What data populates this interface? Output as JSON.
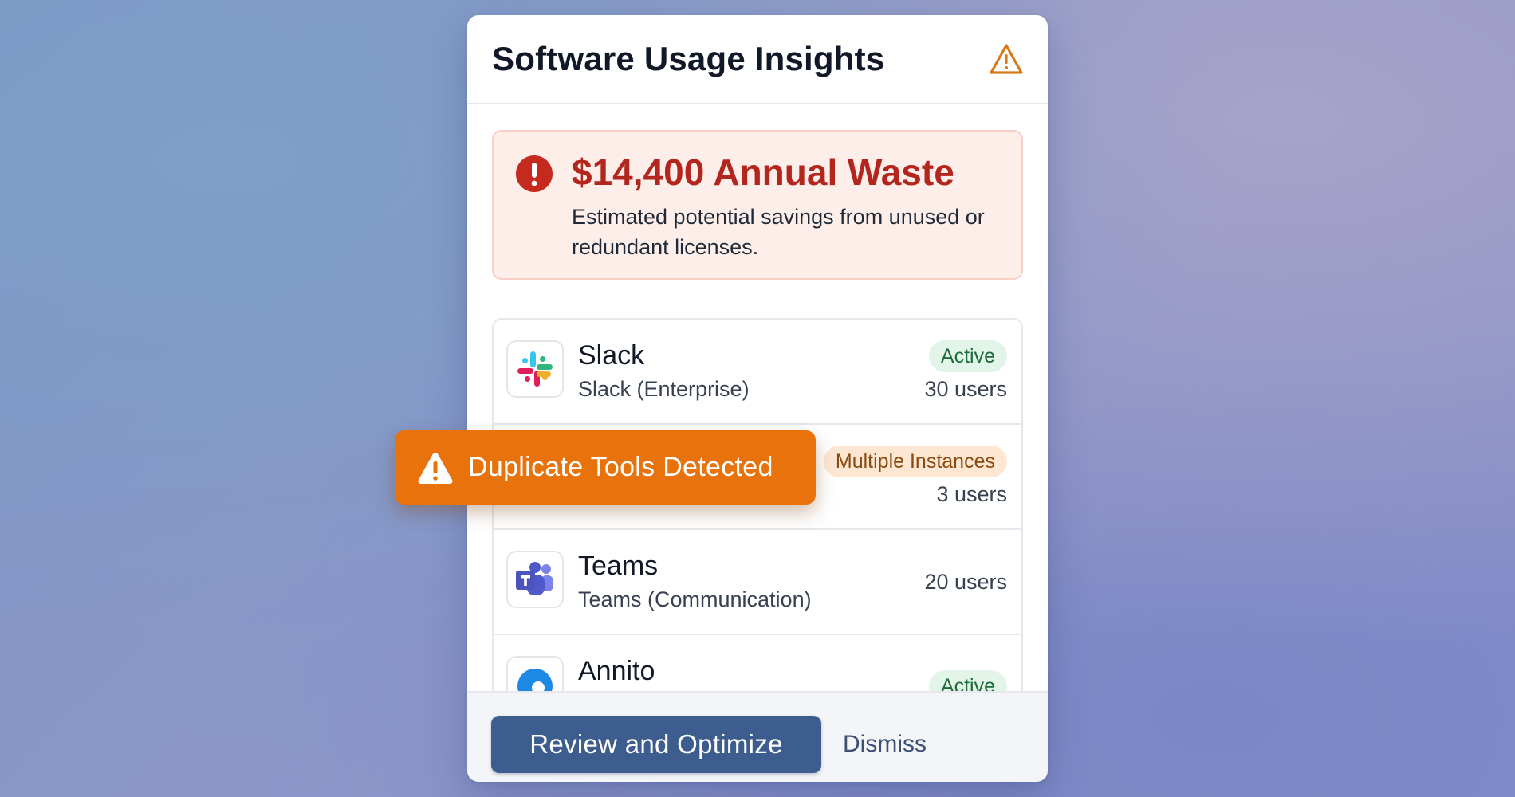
{
  "card": {
    "title": "Software Usage Insights",
    "header_icon": "warning-triangle-icon"
  },
  "waste": {
    "icon": "error-circle-icon",
    "amount": "$14,400 Annual Waste",
    "description": "Estimated potential savings from unused or redundant licenses."
  },
  "apps": [
    {
      "name": "Slack",
      "subtitle": "Slack (Enterprise)",
      "badge": "Active",
      "users": "30 users",
      "logo": "slack-logo-icon"
    },
    {
      "name": "",
      "subtitle": "",
      "badge": "Multiple Instances",
      "users": "3 users",
      "logo": ""
    },
    {
      "name": "Teams",
      "subtitle": "Teams (Communication)",
      "badge": "",
      "users": "20 users",
      "logo": "teams-logo-icon"
    },
    {
      "name": "Annito",
      "subtitle": "",
      "badge": "Active",
      "users": "",
      "logo": "annito-logo-icon"
    }
  ],
  "toast": {
    "icon": "warning-triangle-icon",
    "text": "Duplicate Tools Detected"
  },
  "footer": {
    "primary_label": "Review and Optimize",
    "dismiss_label": "Dismiss"
  },
  "colors": {
    "accent": "#3d5d8f",
    "danger": "#b3261e",
    "warning": "#e8720c",
    "success_bg": "#e3f4e8",
    "success_text": "#1e6b3a"
  }
}
